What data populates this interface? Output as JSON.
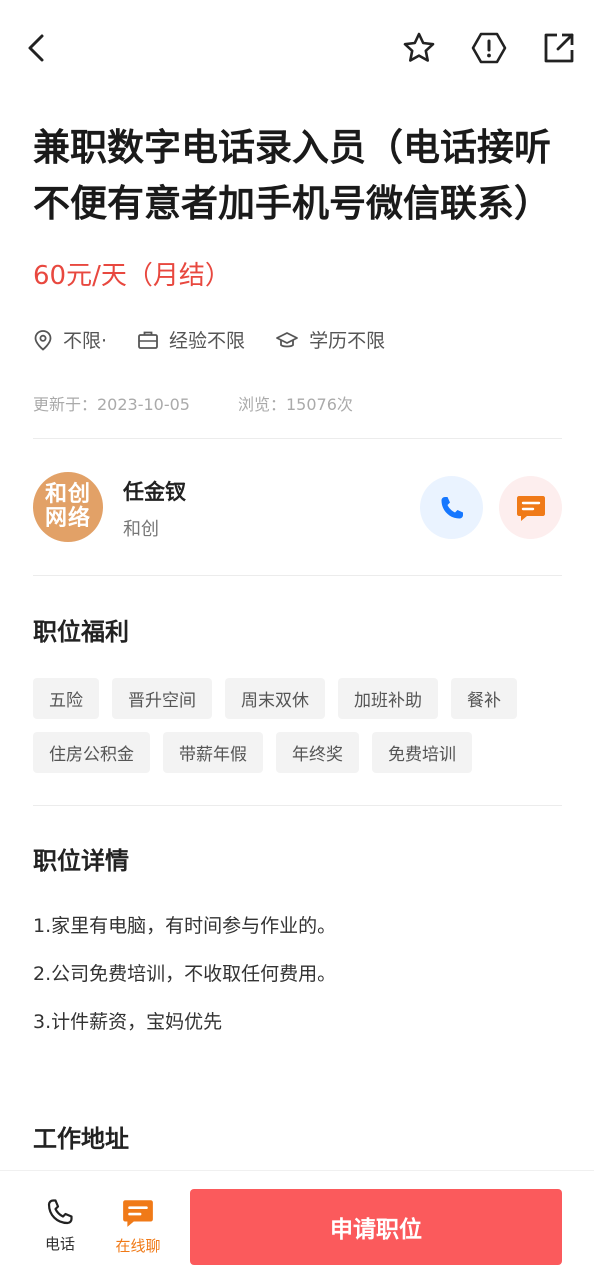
{
  "job": {
    "title": "兼职数字电话录入员（电话接听不便有意者加手机号微信联系）",
    "salary": "60元/天（月结）",
    "location": "不限·",
    "experience": "经验不限",
    "education": "学历不限",
    "updated": "更新于：2023-10-05",
    "views": "浏览：15076次"
  },
  "recruiter": {
    "avatar_line1": "和创",
    "avatar_line2": "网络",
    "name": "任金钗",
    "company": "和创"
  },
  "benefits": {
    "title": "职位福利",
    "tags": [
      "五险",
      "晋升空间",
      "周末双休",
      "加班补助",
      "餐补",
      "住房公积金",
      "带薪年假",
      "年终奖",
      "免费培训"
    ]
  },
  "details": {
    "title": "职位详情",
    "lines": [
      "1.家里有电脑，有时间参与作业的。",
      "2.公司免费培训，不收取任何费用。",
      "3.计件薪资，宝妈优先"
    ]
  },
  "address": {
    "title": "工作地址"
  },
  "bottom": {
    "phone_label": "电话",
    "chat_label": "在线聊",
    "apply_label": "申请职位"
  },
  "colors": {
    "salary": "#e8483f",
    "call_blue": "#1677ff",
    "chat_orange": "#f07a18",
    "apply_red": "#fb5a5c"
  }
}
